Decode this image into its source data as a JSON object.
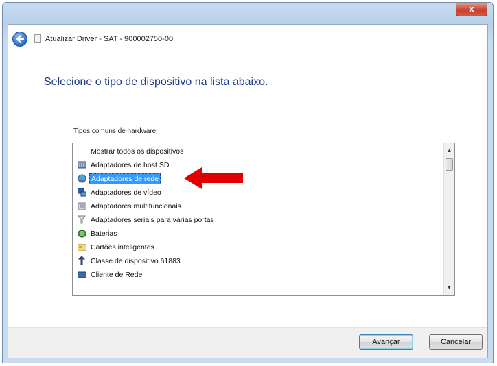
{
  "window": {
    "title": "Atualizar Driver - SAT - 900002750-00",
    "close_label": "x"
  },
  "instruction": "Selecione o tipo de dispositivo na lista abaixo.",
  "list_label": "Tipos comuns de hardware:",
  "list_items": [
    {
      "label": "Mostrar todos os dispositivos",
      "icon": "none",
      "selected": false
    },
    {
      "label": "Adaptadores de host SD",
      "icon": "sd-host-icon",
      "selected": false
    },
    {
      "label": "Adaptadores de rede",
      "icon": "network-adapter-icon",
      "selected": true
    },
    {
      "label": "Adaptadores de vídeo",
      "icon": "display-adapter-icon",
      "selected": false
    },
    {
      "label": "Adaptadores multifuncionais",
      "icon": "multifunction-icon",
      "selected": false
    },
    {
      "label": "Adaptadores seriais para várias portas",
      "icon": "serial-port-icon",
      "selected": false
    },
    {
      "label": "Baterias",
      "icon": "battery-icon",
      "selected": false
    },
    {
      "label": "Cartões inteligentes",
      "icon": "smart-card-icon",
      "selected": false
    },
    {
      "label": "Classe de dispositivo 61883",
      "icon": "device-class-icon",
      "selected": false
    },
    {
      "label": "Cliente de Rede",
      "icon": "network-client-icon",
      "selected": false
    }
  ],
  "buttons": {
    "next": "Avançar",
    "cancel": "Cancelar"
  },
  "colors": {
    "selection": "#3399ff",
    "annotation_arrow": "#e00000",
    "instruction_text": "#1e3a8c"
  }
}
